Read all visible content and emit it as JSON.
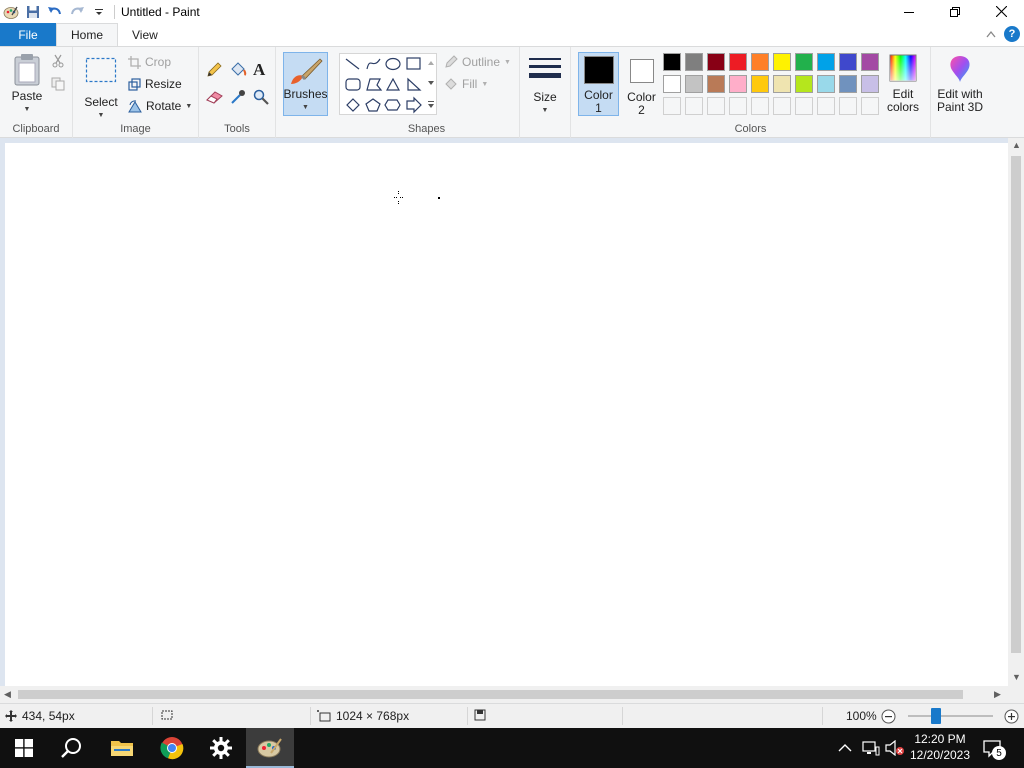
{
  "window": {
    "title": "Untitled - Paint"
  },
  "tabs": {
    "file": "File",
    "home": "Home",
    "view": "View"
  },
  "clipboard": {
    "paste": "Paste",
    "group_label": "Clipboard"
  },
  "image": {
    "select": "Select",
    "crop": "Crop",
    "resize": "Resize",
    "rotate": "Rotate",
    "group_label": "Image"
  },
  "tools": {
    "group_label": "Tools",
    "text_tool_glyph": "A"
  },
  "brushes": {
    "label": "Brushes"
  },
  "shapes": {
    "outline": "Outline",
    "fill": "Fill",
    "group_label": "Shapes"
  },
  "size": {
    "label": "Size"
  },
  "colors": {
    "color1_line1": "Color",
    "color1_line2": "1",
    "color2_line1": "Color",
    "color2_line2": "2",
    "color1": "#000000",
    "color2": "#ffffff",
    "palette_row1": [
      "#000000",
      "#7f7f7f",
      "#880015",
      "#ed1c24",
      "#ff7f27",
      "#fff200",
      "#22b14c",
      "#00a2e8",
      "#3f48cc",
      "#a349a4"
    ],
    "palette_row2": [
      "#ffffff",
      "#c3c3c3",
      "#b97a57",
      "#ffaec9",
      "#ffc90e",
      "#efe4b0",
      "#b5e61d",
      "#99d9ea",
      "#7092be",
      "#c8bfe7"
    ],
    "edit_colors_line1": "Edit",
    "edit_colors_line2": "colors",
    "group_label": "Colors"
  },
  "paint3d": {
    "line1": "Edit with",
    "line2": "Paint 3D"
  },
  "status": {
    "cursor_position": "434, 54px",
    "canvas_size": "1024 × 768px",
    "zoom": "100%",
    "zoom_fraction": 0.33
  },
  "taskbar": {
    "time": "12:20 PM",
    "date": "12/20/2023",
    "notification_count": "5"
  }
}
